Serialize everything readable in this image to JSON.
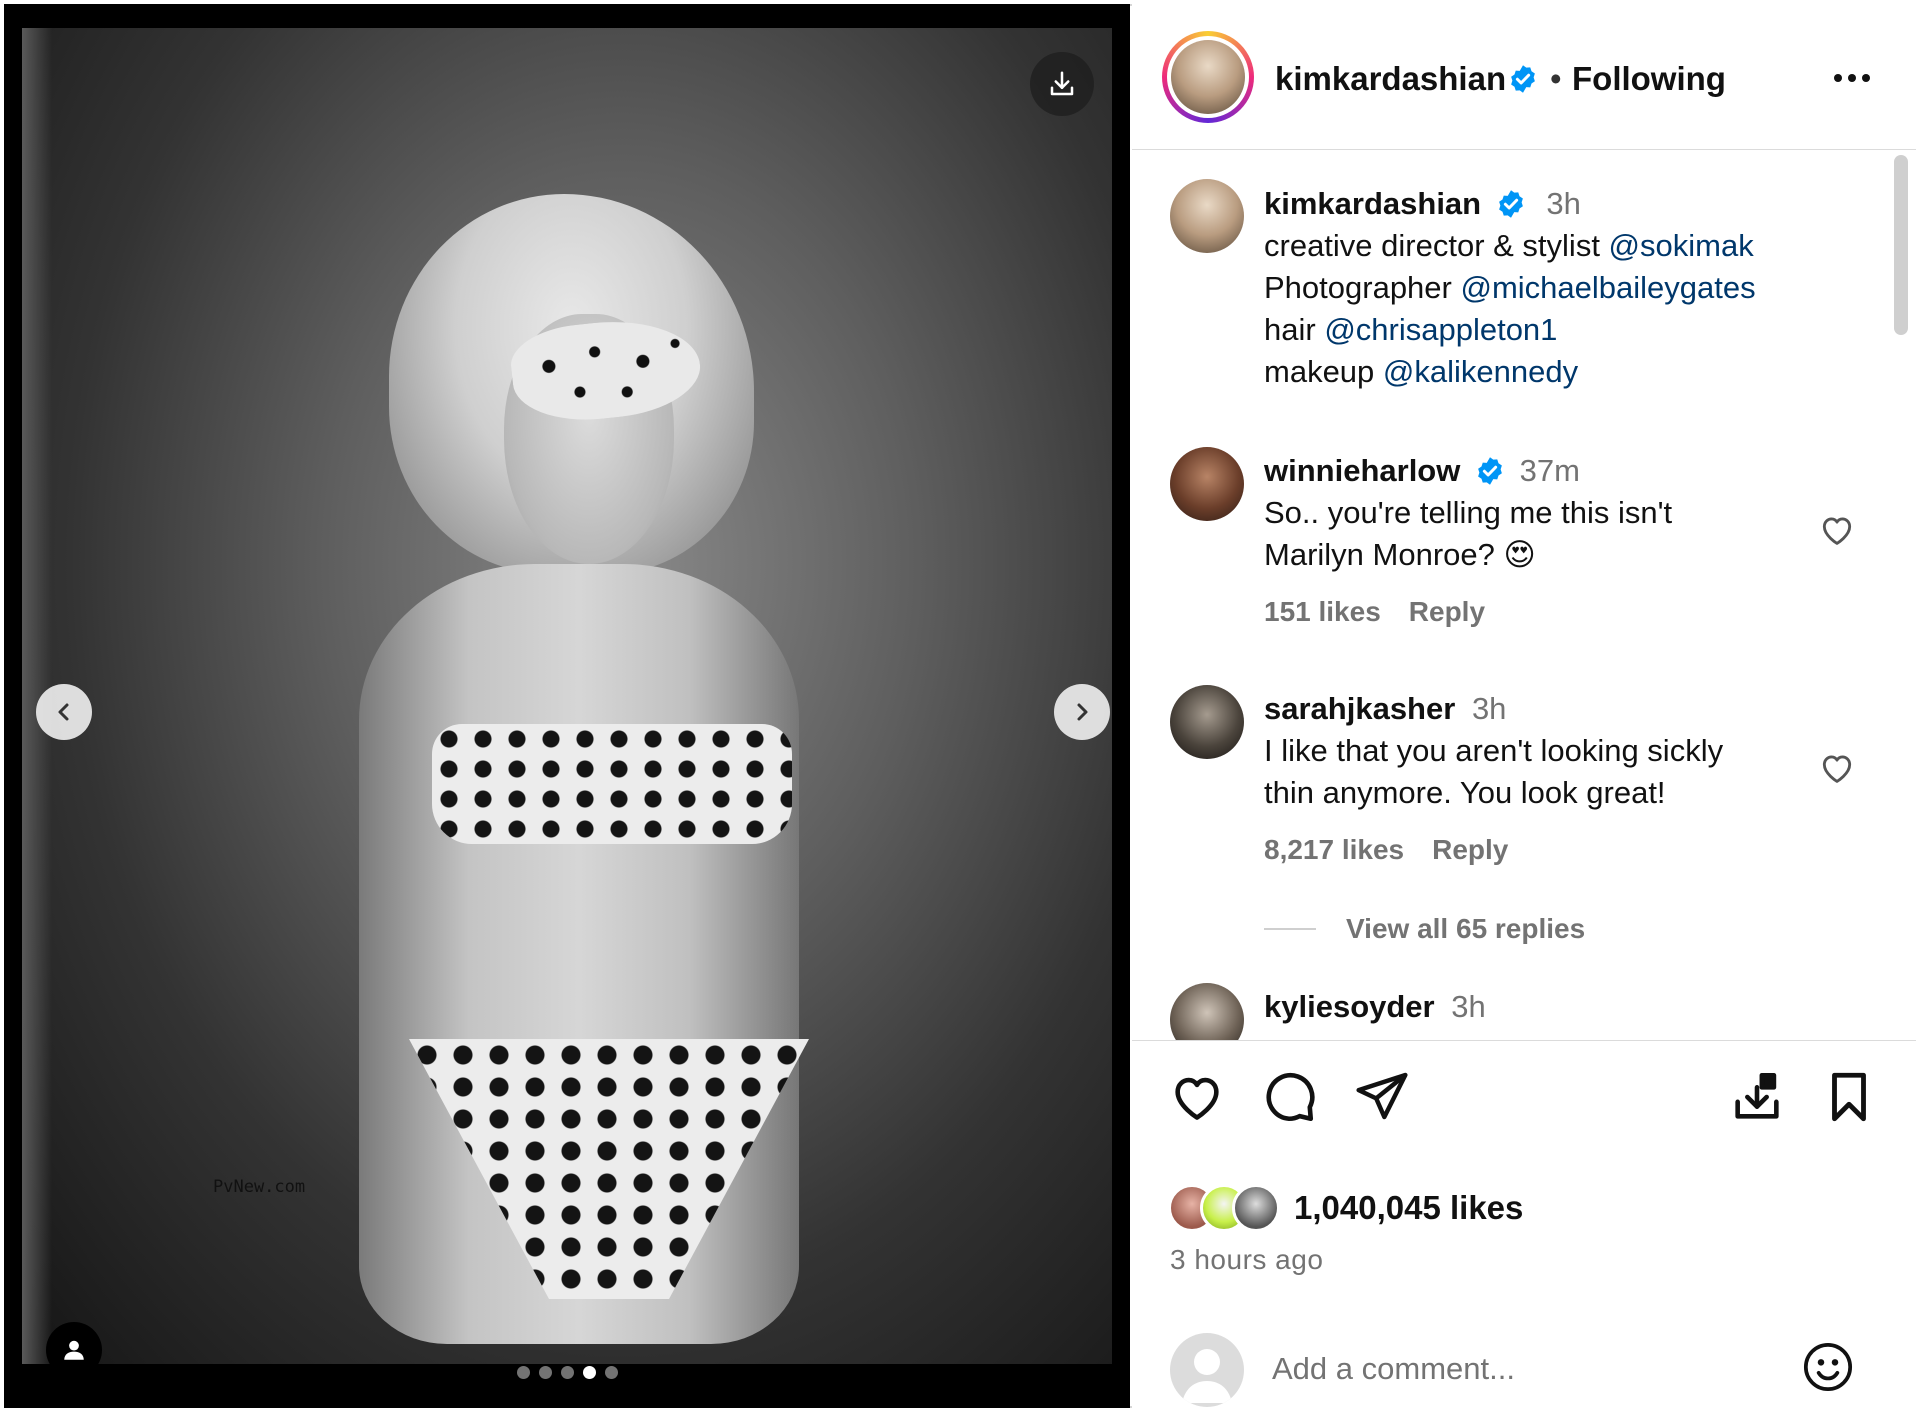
{
  "post": {
    "author": {
      "username": "kimkardashian",
      "follow_status": "Following",
      "separator": "•"
    },
    "media": {
      "carousel_count": 5,
      "carousel_active_index": 3
    },
    "caption": {
      "username": "kimkardashian",
      "time": "3h",
      "lines": [
        {
          "text": "creative director & stylist ",
          "mention": "@sokimak"
        },
        {
          "text": "Photographer ",
          "mention": "@michaelbaileygates"
        },
        {
          "text": "hair ",
          "mention": "@chrisappleton1"
        },
        {
          "text": "makeup ",
          "mention": "@kalikennedy"
        }
      ]
    },
    "comments": [
      {
        "username": "winnieharlow",
        "verified": true,
        "time": "37m",
        "lines": [
          "So.. you're telling me this isn't",
          "Marilyn Monroe? 😍"
        ],
        "likes": "151 likes",
        "reply": "Reply"
      },
      {
        "username": "sarahjkasher",
        "verified": false,
        "time": "3h",
        "lines": [
          "I like that you aren't looking sickly",
          "thin anymore. You look great!"
        ],
        "likes": "8,217 likes",
        "reply": "Reply",
        "view_replies": "View all 65 replies"
      },
      {
        "username": "kyliesoyder",
        "verified": false,
        "time": "3h"
      }
    ],
    "likes": "1,040,045 likes",
    "posted": "3 hours ago",
    "comment_input": {
      "placeholder": "Add a comment..."
    },
    "watermark": "PvNew.com"
  },
  "colors": {
    "link": "#00376b",
    "verified": "#0095f6",
    "muted": "#737373"
  },
  "icons": [
    "download-icon",
    "chevron-left-icon",
    "chevron-right-icon",
    "user-tag-icon",
    "verified-badge-icon",
    "more-icon",
    "heart-icon",
    "comment-icon",
    "share-icon",
    "save-to-collection-icon",
    "bookmark-icon",
    "emoji-icon"
  ]
}
